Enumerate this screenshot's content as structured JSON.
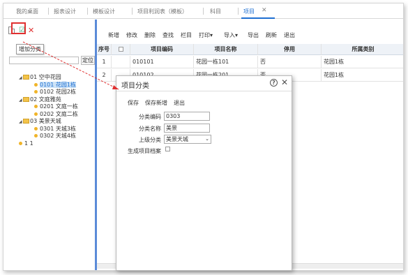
{
  "tabs": [
    "我的桌面",
    "报表设计",
    "模板设计",
    "项目利润表（模板）",
    "科目",
    "项目"
  ],
  "tab_close": "✕",
  "left_toolbar": {
    "add_tooltip": "增加分类",
    "delete_glyph": "✕",
    "edit_glyph": "☑",
    "search_placeholder": "",
    "search_button": "定位"
  },
  "tree": [
    {
      "label": "01 空中花园",
      "level": 0,
      "type": "folder"
    },
    {
      "label": "0101 花园1栋",
      "level": 1,
      "type": "leaf",
      "selected": true
    },
    {
      "label": "0102 花园2栋",
      "level": 1,
      "type": "leaf"
    },
    {
      "label": "02 文庭雅苑",
      "level": 0,
      "type": "folder"
    },
    {
      "label": "0201 文庭一栋",
      "level": 1,
      "type": "leaf"
    },
    {
      "label": "0202 文庭二栋",
      "level": 1,
      "type": "leaf"
    },
    {
      "label": "03 美景天城",
      "level": 0,
      "type": "folder"
    },
    {
      "label": "0301 天城3栋",
      "level": 1,
      "type": "leaf"
    },
    {
      "label": "0302 天城4栋",
      "level": 1,
      "type": "leaf"
    },
    {
      "label": "1 1",
      "level": 0,
      "type": "leaf"
    }
  ],
  "toolbar": [
    "新增",
    "修改",
    "删除",
    "查找",
    "栏目",
    "打印",
    "导入",
    "导出",
    "刷新",
    "退出"
  ],
  "grid": {
    "headers": [
      "序号",
      "",
      "项目编码",
      "项目名称",
      "停用",
      "所属类别"
    ],
    "rows": [
      {
        "no": "1",
        "code": "010101",
        "name": "花园一栋101",
        "disabled": "否",
        "category": "花园1栋"
      },
      {
        "no": "2",
        "code": "010102",
        "name": "花园一栋201",
        "disabled": "否",
        "category": "花园1栋"
      }
    ]
  },
  "dialog": {
    "title": "项目分类",
    "buttons": [
      "保存",
      "保存新增",
      "退出"
    ],
    "fields": {
      "code_label": "分类编码",
      "code_value": "0303",
      "name_label": "分类名称",
      "name_value": "美景",
      "parent_label": "上级分类",
      "parent_value": "美景天城",
      "gen_label": "生成项目档案"
    }
  },
  "colors": {
    "accent": "#1e6fd1",
    "highlight": "#e03030",
    "splitter": "#5b8bd8"
  }
}
